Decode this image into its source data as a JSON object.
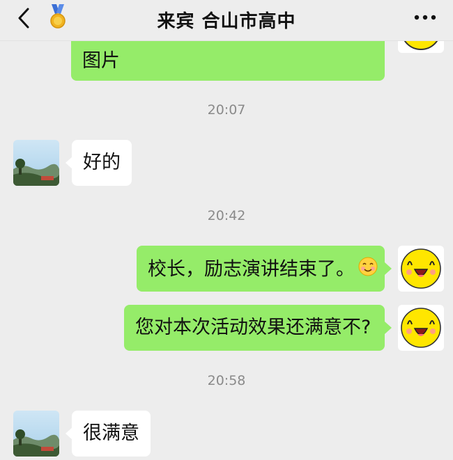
{
  "header": {
    "title": "来宾 合山市高中",
    "back_icon": "chevron-left-icon",
    "medal_icon": "medal-icon",
    "more_icon": "more-dots-icon"
  },
  "messages": [
    {
      "type": "text",
      "side": "right",
      "text": "图片"
    },
    {
      "type": "time",
      "text": "20:07"
    },
    {
      "type": "text",
      "side": "left",
      "text": "好的"
    },
    {
      "type": "time",
      "text": "20:42"
    },
    {
      "type": "text",
      "side": "right",
      "text": "校长，励志演讲结束了。",
      "emoji": "smile-emoji"
    },
    {
      "type": "text",
      "side": "right",
      "text": "您对本次活动效果还满意不?"
    },
    {
      "type": "time",
      "text": "20:58"
    },
    {
      "type": "text",
      "side": "left",
      "text": "很满意"
    }
  ],
  "colors": {
    "background": "#ededed",
    "sent_bubble": "#95ec69",
    "received_bubble": "#ffffff",
    "timestamp": "#8a8a8a"
  }
}
